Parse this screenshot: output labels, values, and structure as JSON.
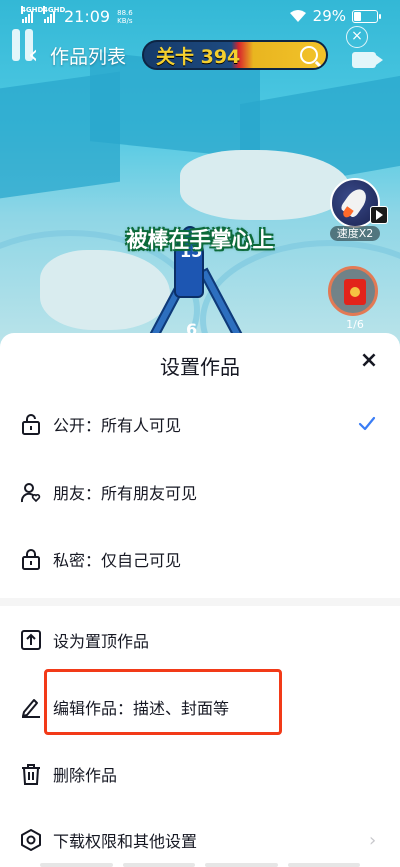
{
  "status_bar": {
    "sim1_label": "4GHD",
    "sim2_label": "4GHD",
    "time": "21:09",
    "net_speed_value": "88.6",
    "net_speed_unit": "KB/s",
    "battery_percent": "29%"
  },
  "header": {
    "title": "作品列表",
    "level_text": "关卡 394"
  },
  "video": {
    "caption": "被棒在手掌心上",
    "figure_number_top": "15",
    "figure_number_bottom": "6"
  },
  "side": {
    "speed_label": "速度X2",
    "redpacket_progress": "1/6"
  },
  "sheet": {
    "title": "设置作品",
    "close_symbol": "×",
    "privacy_options": [
      {
        "label": "公开：所有人可见",
        "icon": "unlock-icon",
        "selected": true
      },
      {
        "label": "朋友：所有朋友可见",
        "icon": "friends-icon",
        "selected": false
      },
      {
        "label": "私密：仅自己可见",
        "icon": "lock-icon",
        "selected": false
      }
    ],
    "actions": [
      {
        "label": "设为置顶作品",
        "icon": "pin-top-icon"
      },
      {
        "label": "编辑作品：描述、封面等",
        "icon": "edit-icon",
        "highlighted": true
      },
      {
        "label": "删除作品",
        "icon": "trash-icon"
      },
      {
        "label": "下载权限和其他设置",
        "icon": "settings-icon",
        "has_chevron": true
      }
    ]
  },
  "colors": {
    "accent_check": "#3a7df5",
    "highlight_border": "#f23a18",
    "text_primary": "#161823"
  }
}
